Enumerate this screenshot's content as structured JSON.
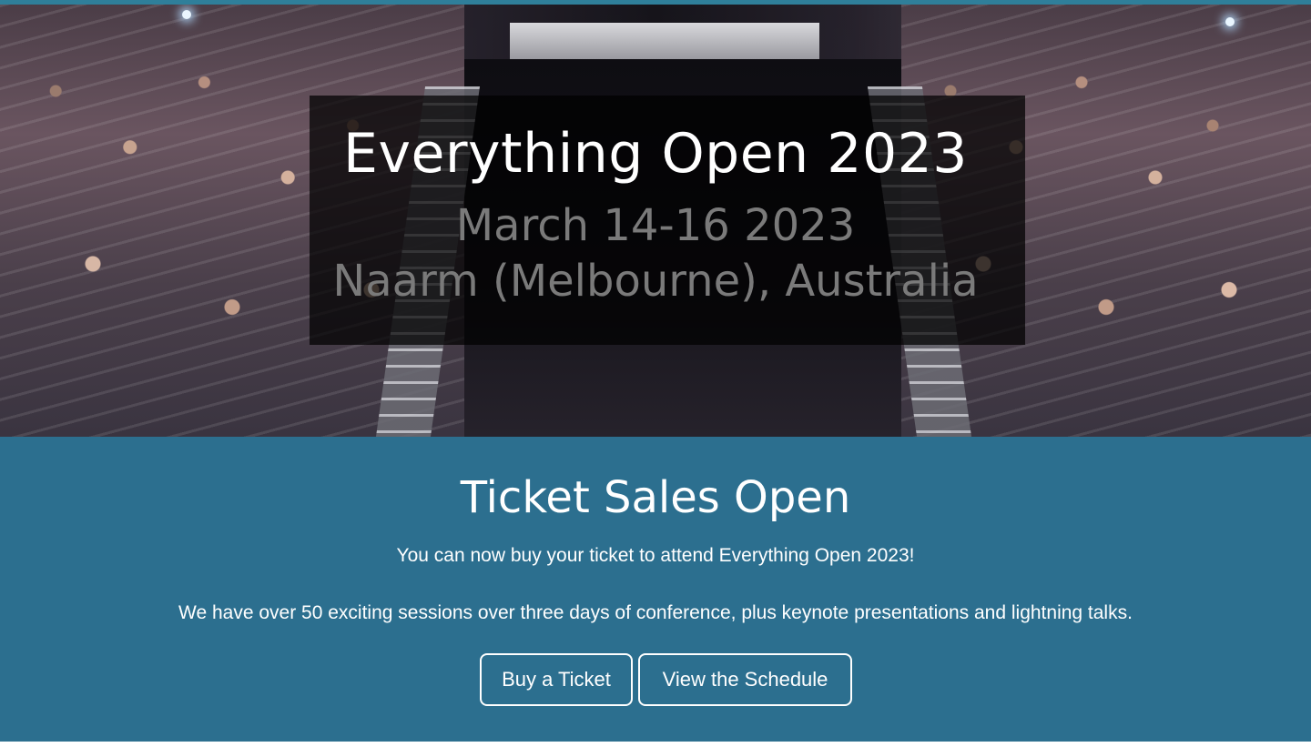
{
  "hero": {
    "title": "Everything Open 2023",
    "dates": "March 14-16 2023",
    "location": "Naarm (Melbourne), Australia"
  },
  "tickets": {
    "heading": "Ticket Sales Open",
    "line1": "You can now buy your ticket to attend Everything Open 2023!",
    "line2": "We have over 50 exciting sessions over three days of conference, plus keynote presentations and lightning talks.",
    "buy_label": "Buy a Ticket",
    "schedule_label": "View the Schedule"
  },
  "colors": {
    "accent_teal": "#2f7f9a",
    "section_blue": "#2c6f8f",
    "title_panel": "rgba(0,0,0,0.72)",
    "subtitle_gray": "#7a7a7a"
  }
}
